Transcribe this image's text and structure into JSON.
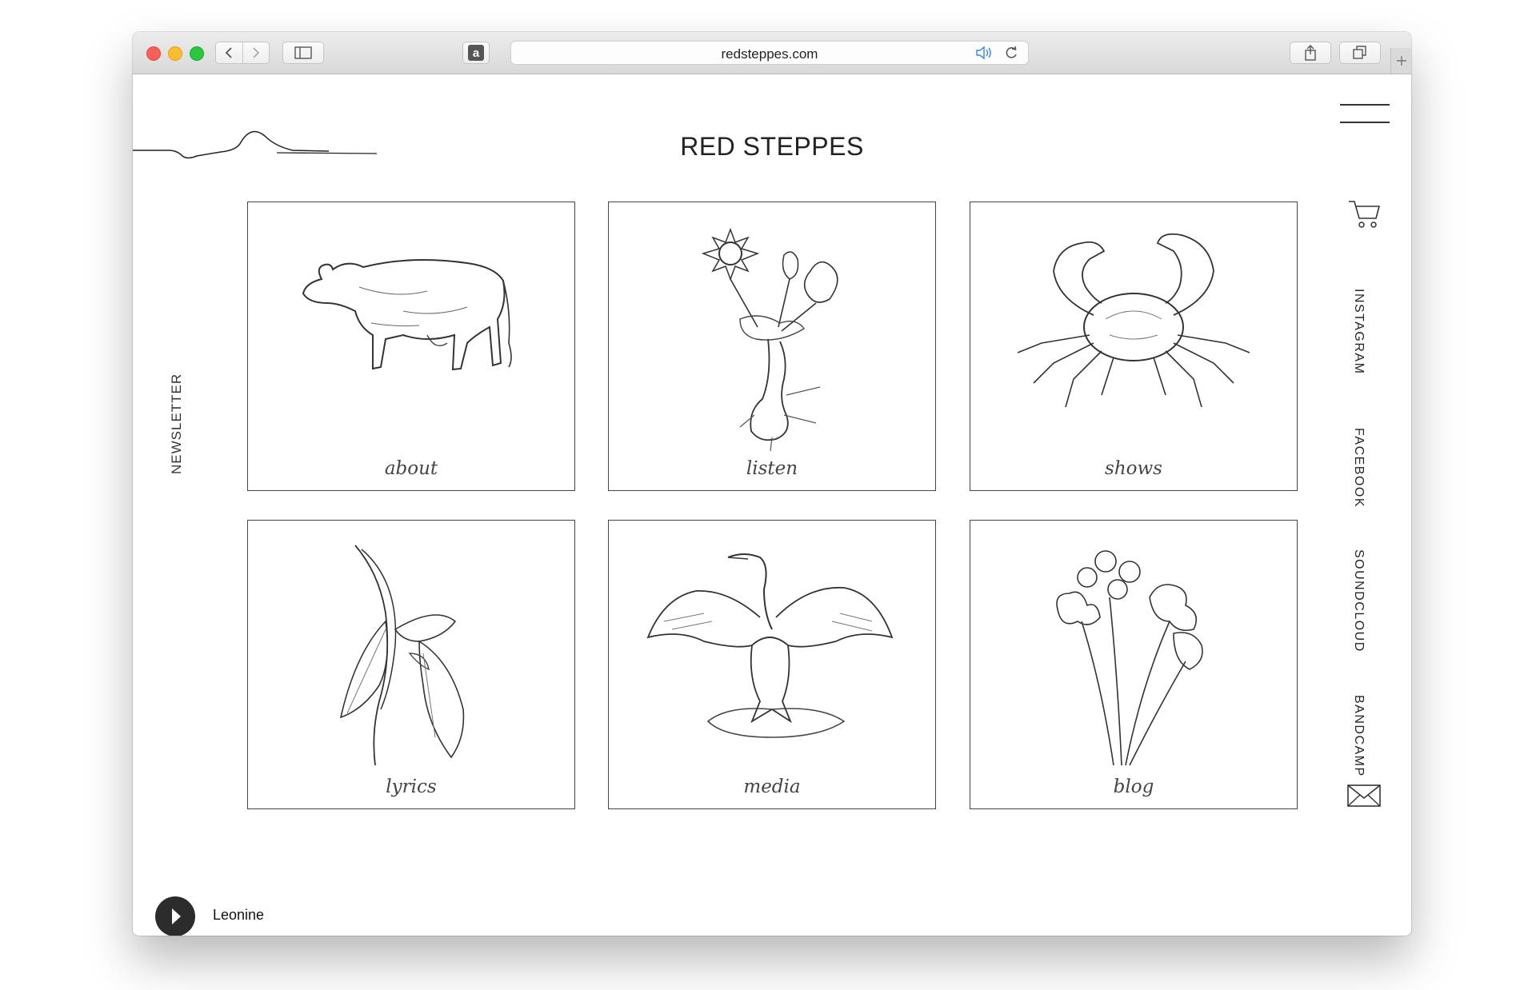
{
  "browser": {
    "url": "redsteppes.com",
    "amazon_label": "a"
  },
  "site": {
    "title": "RED STEPPES",
    "newsletter": "NEWSLETTER"
  },
  "tiles": [
    {
      "label": "about",
      "illustration": "cow-icon"
    },
    {
      "label": "listen",
      "illustration": "flowers-icon"
    },
    {
      "label": "shows",
      "illustration": "crab-icon"
    },
    {
      "label": "lyrics",
      "illustration": "leaves-icon"
    },
    {
      "label": "media",
      "illustration": "cormorant-icon"
    },
    {
      "label": "blog",
      "illustration": "clover-icon"
    }
  ],
  "social": {
    "instagram": "INSTAGRAM",
    "facebook": "FACEBOOK",
    "soundcloud": "SOUNDCLOUD",
    "bandcamp": "BANDCAMP"
  },
  "player": {
    "track": "Leonine"
  }
}
